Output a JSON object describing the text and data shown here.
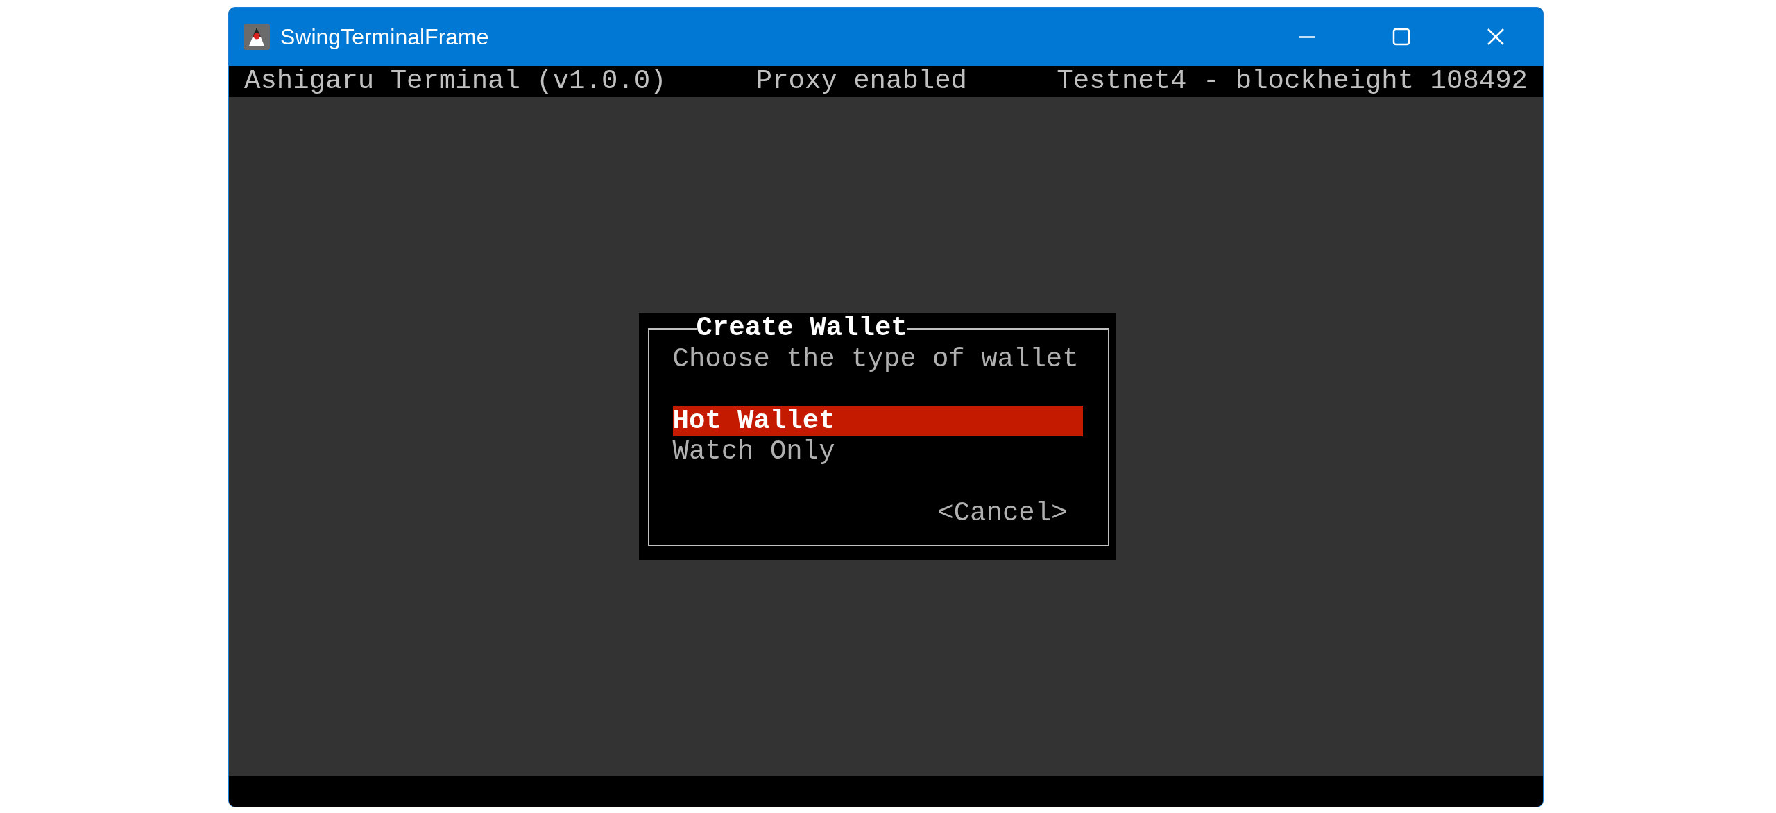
{
  "window": {
    "title": "SwingTerminalFrame"
  },
  "status_bar": {
    "app": "Ashigaru Terminal (v1.0.0)",
    "proxy": "Proxy enabled",
    "network": "Testnet4 - blockheight 108492"
  },
  "dialog": {
    "title": "Create Wallet",
    "prompt": "Choose the type of wallet",
    "options": [
      {
        "label": "Hot Wallet",
        "selected": true
      },
      {
        "label": "Watch Only",
        "selected": false
      }
    ],
    "buttons": [
      {
        "label": "<Cancel>",
        "selected": false
      }
    ]
  }
}
